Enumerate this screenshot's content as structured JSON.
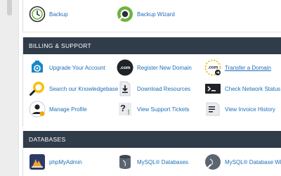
{
  "top_section": {
    "items": [
      {
        "label": "Backup",
        "icon": "backup-icon"
      },
      {
        "label": "Backup Wizard",
        "icon": "backup-wizard-icon"
      }
    ]
  },
  "billing": {
    "title": "BILLING & SUPPORT",
    "items": [
      {
        "label": "Upgrade Your Account",
        "icon": "upgrade-account-icon"
      },
      {
        "label": "Register New Domain",
        "icon": "register-domain-icon",
        "icon_text": ".com"
      },
      {
        "label": "Transfer a Domain",
        "icon": "transfer-domain-icon",
        "icon_text": ".com"
      },
      {
        "label": "Search our Knowledgebase",
        "icon": "knowledgebase-icon"
      },
      {
        "label": "Download Resources",
        "icon": "download-resources-icon"
      },
      {
        "label": "Check Network Status",
        "icon": "network-status-icon"
      },
      {
        "label": "Manage Profile",
        "icon": "manage-profile-icon"
      },
      {
        "label": "View Support Tickets",
        "icon": "support-tickets-icon"
      },
      {
        "label": "View Invoice History",
        "icon": "invoice-history-icon"
      }
    ]
  },
  "databases": {
    "title": "DATABASES",
    "items": [
      {
        "label": "phpMyAdmin",
        "icon": "phpmyadmin-icon"
      },
      {
        "label": "MySQL® Databases",
        "icon": "mysql-databases-icon"
      },
      {
        "label": "MySQL® Database Wizar",
        "icon": "mysql-wizard-icon"
      }
    ]
  },
  "colors": {
    "header_bg": "#313c4a",
    "link": "#1e6fb9",
    "green": "#6db33f",
    "dark": "#1f2328",
    "blue": "#1a86c8"
  }
}
